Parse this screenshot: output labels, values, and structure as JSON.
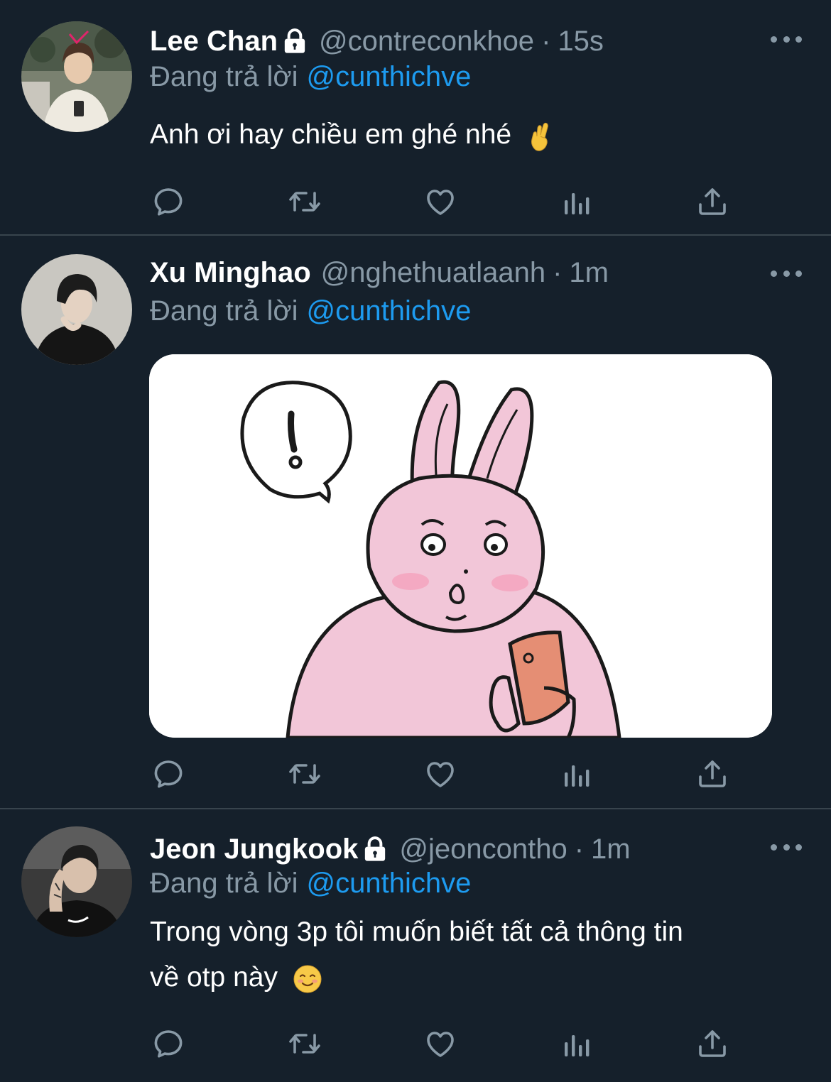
{
  "reply_prefix": "Đang trả lời",
  "tweets": [
    {
      "name": "Lee Chan",
      "protected": true,
      "handle": "@contreconkhoe",
      "separator": "·",
      "time": "15s",
      "reply_to": "@cunthichve",
      "text": "Anh ơi hay chiều em ghé nhé",
      "emoji": "crossed-fingers"
    },
    {
      "name": "Xu Minghao",
      "protected": false,
      "handle": "@nghethuatlaanh",
      "separator": "·",
      "time": "1m",
      "reply_to": "@cunthichve",
      "media": "pink bunny sticker holding phone with exclamation speech bubble"
    },
    {
      "name": "Jeon Jungkook",
      "protected": true,
      "handle": "@jeoncontho",
      "separator": "·",
      "time": "1m",
      "reply_to": "@cunthichve",
      "text_line1": "Trong vòng 3p tôi muốn biết tất cả thông tin",
      "text_line2": "về otp này",
      "emoji": "smiling-face"
    }
  ],
  "action_icons": [
    "reply-icon",
    "retweet-icon",
    "like-icon",
    "analytics-icon",
    "share-icon"
  ],
  "colors": {
    "background": "#15202b",
    "text": "#ffffff",
    "secondary": "#8899a6",
    "link": "#1d9bf0",
    "divider": "#38444d"
  }
}
